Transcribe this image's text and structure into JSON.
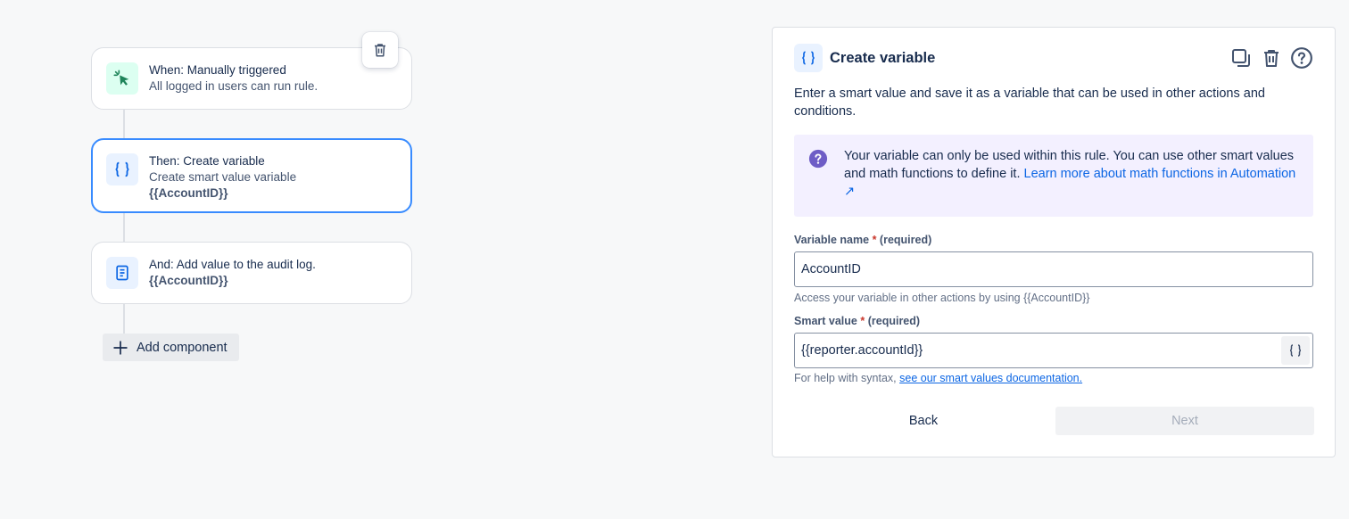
{
  "flow": {
    "trigger": {
      "title": "When: Manually triggered",
      "subtitle": "All logged in users can run rule."
    },
    "action": {
      "title": "Then: Create variable",
      "subtitle": "Create smart value variable",
      "value": "{{AccountID}}"
    },
    "audit": {
      "title": "And: Add value to the audit log.",
      "value": "{{AccountID}}"
    },
    "add_component_label": "Add component"
  },
  "panel": {
    "icon_text": "{ }",
    "title": "Create variable",
    "description": "Enter a smart value and save it as a variable that can be used in other actions and conditions.",
    "info": {
      "text": "Your variable can only be used within this rule. You can use other smart values and math functions to define it.",
      "link_text": "Learn more about math functions in Automation ↗"
    },
    "variable_name": {
      "label": "Variable name",
      "required_mark": "*",
      "required_text": "(required)",
      "value": "AccountID",
      "helper": "Access your variable in other actions by using {{AccountID}}"
    },
    "smart_value": {
      "label": "Smart value",
      "required_mark": "*",
      "required_text": "(required)",
      "value": "{{reporter.accountId}}",
      "button_text": "{ }",
      "helper_prefix": "For help with syntax,",
      "helper_link": "see our smart values documentation."
    },
    "back_label": "Back",
    "next_label": "Next"
  },
  "colors": {
    "selected_border": "#388bff",
    "link": "#0c66e4",
    "info_bg": "#f3f0ff",
    "info_icon": "#6e5dc6",
    "trigger_icon": "#1f845a",
    "required": "#c9372c"
  },
  "icons": {
    "trigger": "cursor-click-icon",
    "action": "braces-icon",
    "audit": "document-icon",
    "delete": "trash-icon",
    "duplicate": "copy-icon",
    "help": "question-icon"
  }
}
